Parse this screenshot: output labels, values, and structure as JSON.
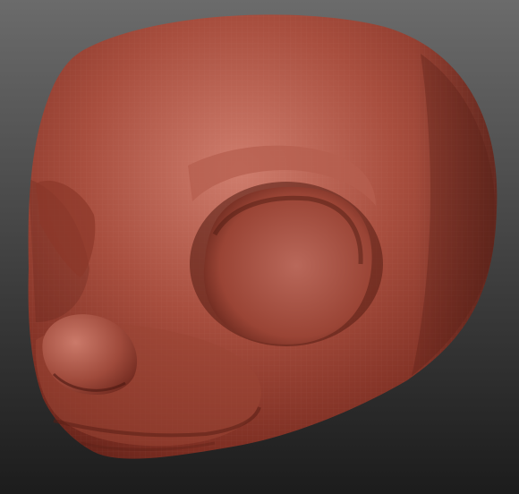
{
  "scene": {
    "subject": "sculpted-head-model",
    "material_colors": {
      "base": "#a14a3a",
      "shadow": "#5a1f16",
      "highlight": "#d98c7c",
      "background_top": "#6b6b6b",
      "background_bottom": "#1c1c1c"
    },
    "features": [
      "head",
      "eye-socket",
      "brow",
      "snout",
      "nose",
      "mouth",
      "mesh-wireframe"
    ]
  }
}
